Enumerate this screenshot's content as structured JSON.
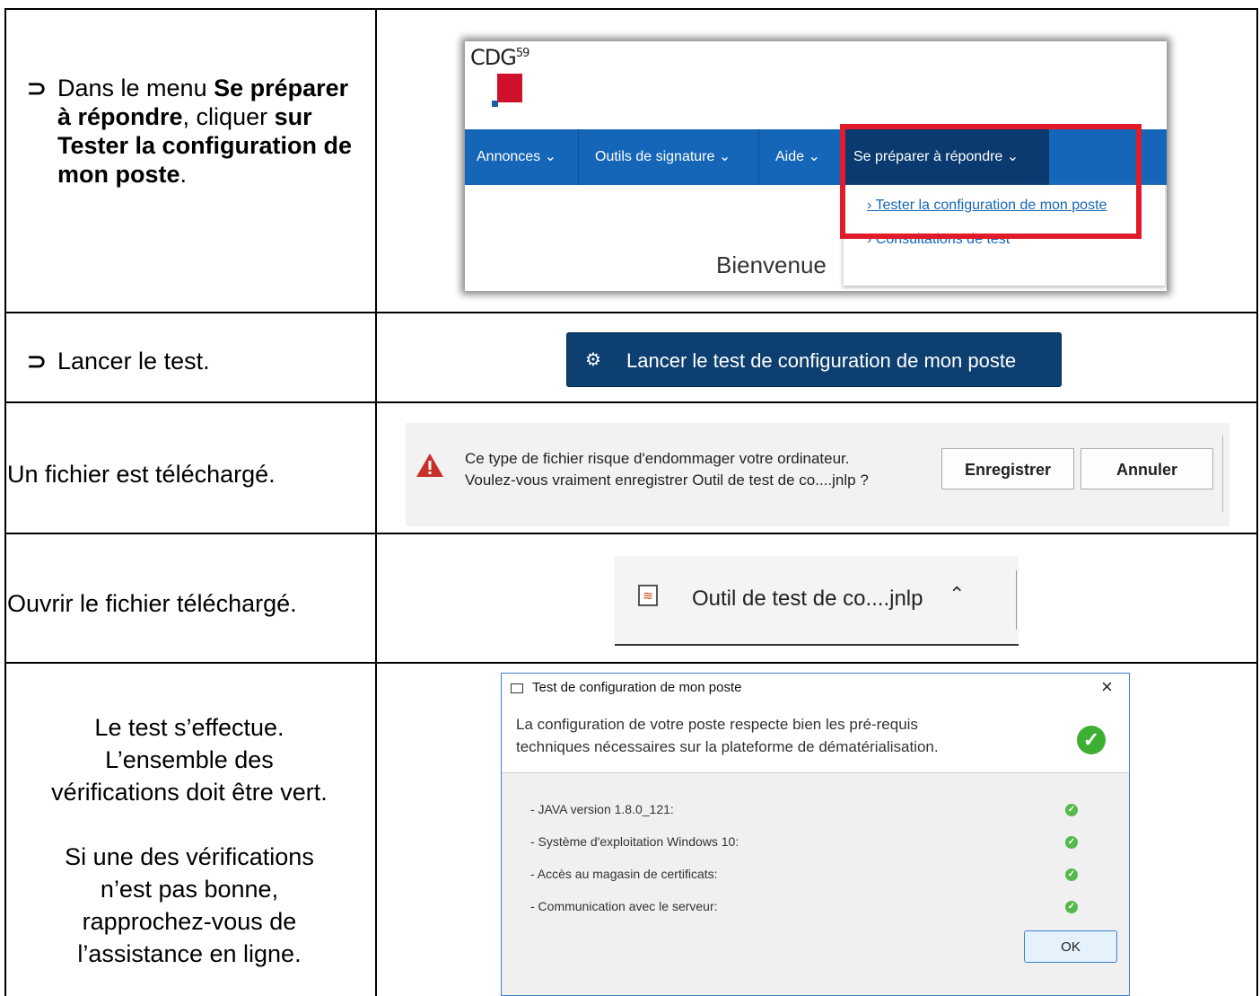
{
  "rows": [
    {
      "instruction_parts": [
        {
          "text": "Dans le menu ",
          "bold": false
        },
        {
          "text": "Se préparer à répondre",
          "bold": true
        },
        {
          "text": ", cliquer ",
          "bold": false
        },
        {
          "text": "sur Tester la configuration de mon poste",
          "bold": true
        },
        {
          "text": ".",
          "bold": false
        }
      ]
    },
    {
      "instruction": "Lancer le test."
    },
    {
      "instruction": "Un fichier est téléchargé."
    },
    {
      "instruction": "Ouvrir le fichier téléchargé."
    },
    {
      "instruction_lines": [
        "Le test s’effectue.",
        "L’ensemble des",
        "vérifications doit être vert.",
        "",
        "Si une des vérifications",
        "n’est pas bonne,",
        "rapprochez-vous de",
        "l’assistance en ligne."
      ]
    }
  ],
  "cdg": {
    "logo_text": "CDG",
    "logo_sup": "59",
    "nav": [
      "Annonces",
      "Outils de signature",
      "Aide",
      "Se préparer à répondre"
    ],
    "dropdown": [
      "Tester la configuration de mon poste",
      "Consultations de test"
    ],
    "welcome": "Bienvenue"
  },
  "launch_button": "Lancer le test de configuration de mon poste",
  "download_bar": {
    "line1": "Ce type de fichier risque d'endommager votre ordinateur.",
    "line2": "Voulez-vous vraiment enregistrer Outil de test de co....jnlp ?",
    "save": "Enregistrer",
    "cancel": "Annuler"
  },
  "downloaded_file": "Outil de test de co....jnlp",
  "dialog": {
    "title": "Test de configuration de mon poste",
    "message_line1": "La configuration de votre poste respecte bien les pré-requis",
    "message_line2": "techniques nécessaires sur la plateforme de dématérialisation.",
    "checks": [
      "- JAVA version 1.8.0_121:",
      "- Système d'exploitation Windows 10:",
      "- Accès au magasin de certificats:",
      "- Communication avec le serveur:"
    ],
    "ok": "OK"
  },
  "colors": {
    "nav_blue": "#1566b8",
    "highlight_red": "#e21b2a",
    "button_navy": "#0d3f70",
    "check_green": "#3db033"
  }
}
